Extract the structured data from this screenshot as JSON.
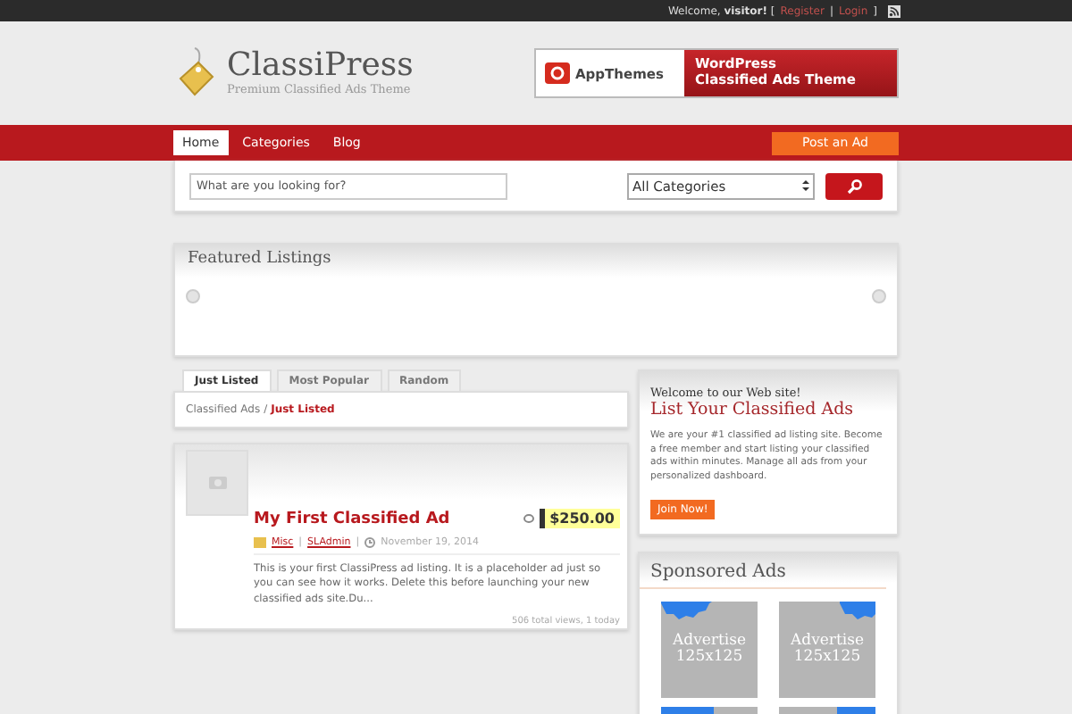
{
  "topbar": {
    "welcome": "Welcome, **visitor!** [",
    "links": [
      "Register",
      "Login"
    ],
    "separator": "|",
    "close": "]"
  },
  "header": {
    "title": "ClassiPress",
    "tagline": "Premium Classified Ads Theme"
  },
  "banner": {
    "brand": "AppThemes",
    "headline": [
      "WordPress",
      "Classified Ads Theme"
    ]
  },
  "nav": {
    "items": [
      {
        "label": "Home",
        "selected": true
      },
      {
        "label": "Categories",
        "selected": false
      },
      {
        "label": "Blog",
        "selected": false
      }
    ],
    "post_button": "Post an Ad"
  },
  "search": {
    "placeholder": "What are you looking for?",
    "category": "All Categories"
  },
  "featured": {
    "title": "Featured Listings"
  },
  "tabs": [
    {
      "label": "Just Listed",
      "selected": true
    },
    {
      "label": "Most Popular",
      "selected": false
    },
    {
      "label": "Random",
      "selected": false
    }
  ],
  "breadcrumb": {
    "parent": "Classified Ads",
    "separator": "/",
    "current": "Just Listed"
  },
  "listing": {
    "title": "My First Classified Ad",
    "price": "$250.00",
    "category": "Misc",
    "author": "SLAdmin",
    "date": "November 19, 2014",
    "meta_separator": "|",
    "description": "This is your first ClassiPress ad listing. It is a placeholder ad just so you can see how it works. Delete this before launching your new classified ads site.Du...",
    "stats": "506 total views, 1 today"
  },
  "welcome": {
    "kicker": "Welcome to our Web site!",
    "title": "List Your Classified Ads",
    "body": "We are your #1 classified ad listing site. Become a free member and start listing your classified ads within minutes. Manage all ads from your personalized dashboard.",
    "button": "Join Now!"
  },
  "sponsored": {
    "title": "Sponsored Ads",
    "ads": [
      {
        "kind": "left",
        "lines": [
          "Advertise",
          "125x125"
        ]
      },
      {
        "kind": "right",
        "lines": [
          "Advertise",
          "125x125"
        ]
      },
      {
        "kind": "left"
      },
      {
        "kind": "right"
      }
    ]
  }
}
